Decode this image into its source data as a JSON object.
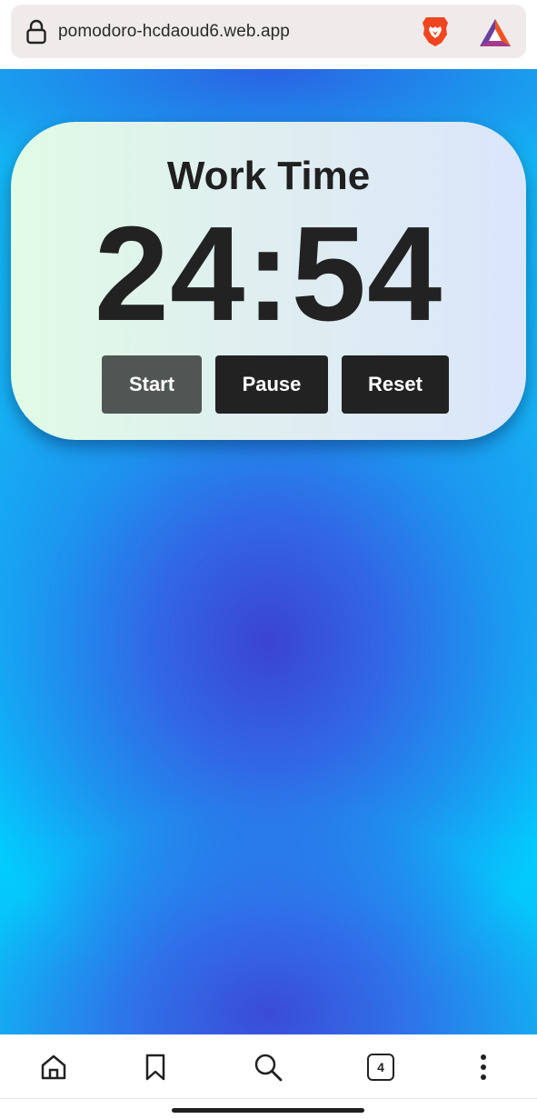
{
  "browser": {
    "url": "pomodoro-hcdaoud6.web.app",
    "icons": [
      "lock-icon",
      "brave-icon",
      "bat-rewards-icon"
    ]
  },
  "timer_card": {
    "mode_title": "Work Time",
    "time": "24:54",
    "buttons": {
      "start": "Start",
      "pause": "Pause",
      "reset": "Reset"
    }
  },
  "bottom_nav": {
    "tab_count": "4",
    "icons": [
      "home-icon",
      "bookmark-icon",
      "search-icon",
      "tabs-icon",
      "more-menu-icon"
    ]
  },
  "colors": {
    "card_text": "#222222",
    "button_dark": "#222222",
    "button_start": "#4f5654",
    "background_cyan": "#00cfff",
    "background_blue": "#3b44d2"
  }
}
